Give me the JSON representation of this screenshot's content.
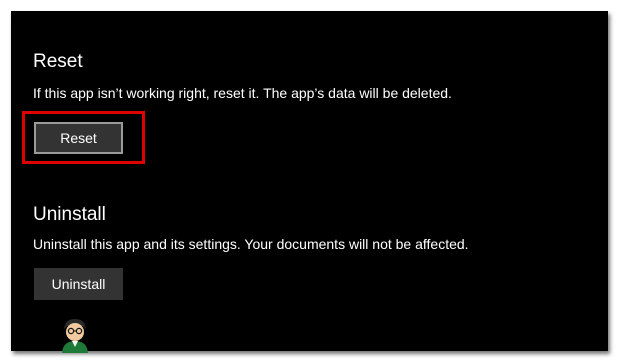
{
  "reset": {
    "title": "Reset",
    "description": "If this app isn’t working right, reset it. The app’s data will be deleted.",
    "button_label": "Reset"
  },
  "uninstall": {
    "title": "Uninstall",
    "description": "Uninstall this app and its settings. Your documents will not be affected.",
    "button_label": "Uninstall"
  },
  "colors": {
    "background": "#000000",
    "text": "#ffffff",
    "button": "#333333",
    "highlight": "#e00000"
  },
  "icons": {
    "watermark": "appuals-mascot-icon"
  }
}
